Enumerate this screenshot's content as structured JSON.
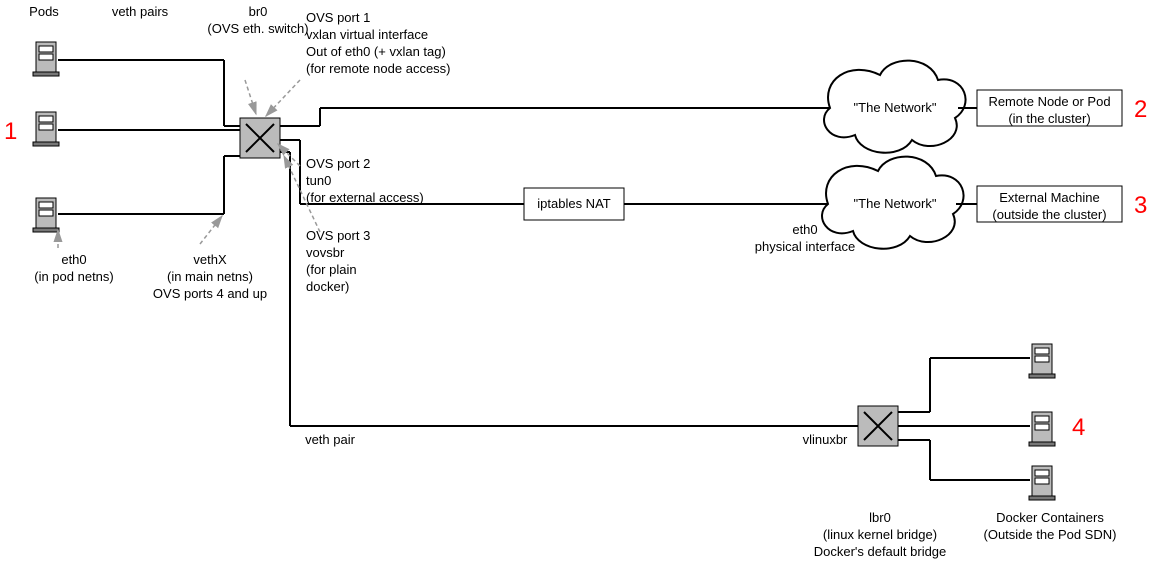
{
  "headers": {
    "pods": "Pods",
    "veth_pairs": "veth pairs",
    "br0": "br0\n(OVS eth. switch)"
  },
  "port1": "OVS port 1\nvxlan virtual interface\nOut of eth0 (+ vxlan tag)\n(for remote node access)",
  "port2": "OVS port 2\ntun0\n(for external access)",
  "port3": "OVS port 3\nvovsbr\n(for plain\ndocker)",
  "eth0_pod": "eth0\n(in pod netns)",
  "vethx": "vethX\n(in main netns)\nOVS ports 4 and up",
  "iptables": "iptables NAT",
  "eth0_phys": "eth0\nphysical interface",
  "net1": "\"The Network\"",
  "net2": "\"The Network\"",
  "remote_node": "Remote Node or Pod\n(in the cluster)",
  "external_machine": "External Machine\n(outside the cluster)",
  "veth_pair_bottom": "veth pair",
  "vlinuxbr": "vlinuxbr",
  "lbr0": "lbr0\n(linux kernel bridge)\nDocker's default bridge",
  "docker_containers": "Docker Containers\n(Outside the Pod SDN)",
  "numbers": {
    "n1": "1",
    "n2": "2",
    "n3": "3",
    "n4": "4"
  }
}
